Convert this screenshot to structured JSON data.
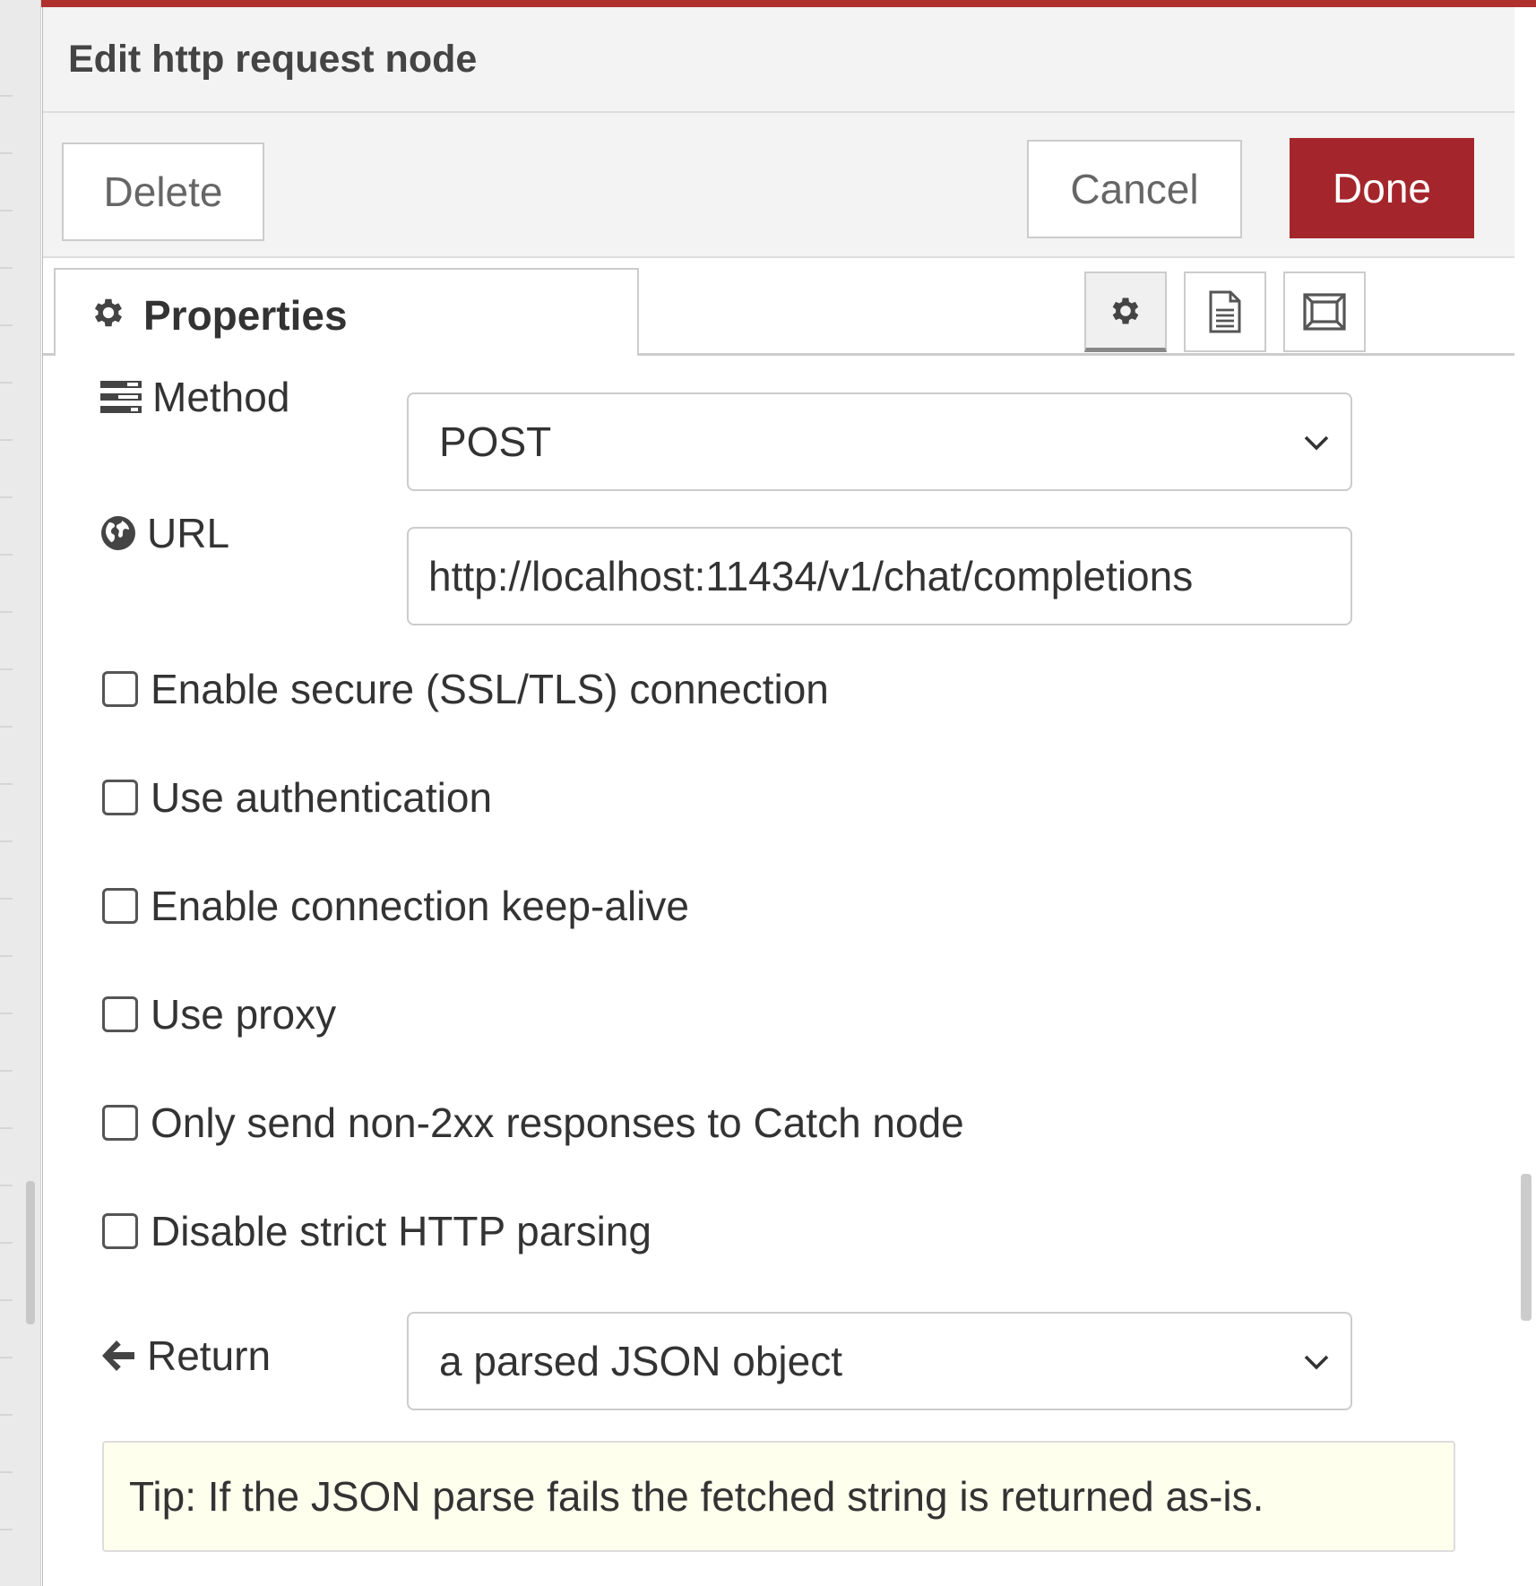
{
  "tray": {
    "title": "Edit http request node"
  },
  "toolbar": {
    "delete_label": "Delete",
    "cancel_label": "Cancel",
    "done_label": "Done"
  },
  "tabs": {
    "properties_label": "Properties",
    "properties_icon": "gear-icon",
    "icon_tabs": [
      "gear-icon",
      "document-icon",
      "frame-icon"
    ],
    "active_icon_tab": "gear-icon"
  },
  "form": {
    "method": {
      "label": "Method",
      "icon": "tasks-icon",
      "value": "POST"
    },
    "url": {
      "label": "URL",
      "icon": "globe-icon",
      "value": "http://localhost:11434/v1/chat/completions"
    },
    "checkboxes": [
      {
        "label": "Enable secure (SSL/TLS) connection",
        "checked": false
      },
      {
        "label": "Use authentication",
        "checked": false
      },
      {
        "label": "Enable connection keep-alive",
        "checked": false
      },
      {
        "label": "Use proxy",
        "checked": false
      },
      {
        "label": "Only send non-2xx responses to Catch node",
        "checked": false
      },
      {
        "label": "Disable strict HTTP parsing",
        "checked": false
      }
    ],
    "return": {
      "label": "Return",
      "icon": "arrow-left-icon",
      "value": "a parsed JSON object"
    },
    "tip": "Tip: If the JSON parse fails the fetched string is returned as-is."
  },
  "colors": {
    "accent_bar": "#b0302e",
    "done_button": "#a4262c",
    "tip_background": "#ffffee"
  }
}
